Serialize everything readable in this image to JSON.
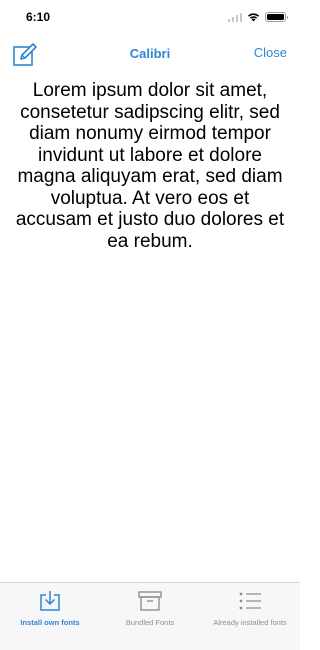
{
  "status_bar": {
    "time": "6:10"
  },
  "nav": {
    "title": "Calibri",
    "close_label": "Close",
    "edit_icon": "edit-icon"
  },
  "content": {
    "sample_text": "Lorem ipsum dolor sit amet, consetetur sadipscing elitr, sed diam nonumy eirmod tempor invidunt ut labore et dolore magna aliquyam erat, sed diam voluptua. At vero eos et accusam et justo duo dolores et ea rebum."
  },
  "tab_bar": {
    "tabs": [
      {
        "label": "Install own fonts",
        "icon": "download-tray-icon",
        "active": true
      },
      {
        "label": "Bundled Fonts",
        "icon": "archive-box-icon",
        "active": false
      },
      {
        "label": "Already installed fonts",
        "icon": "list-icon",
        "active": false
      }
    ]
  },
  "colors": {
    "accent": "#2f86d4",
    "inactive": "#8e8e8e",
    "tab_bar_bg": "#f7f7f7"
  }
}
